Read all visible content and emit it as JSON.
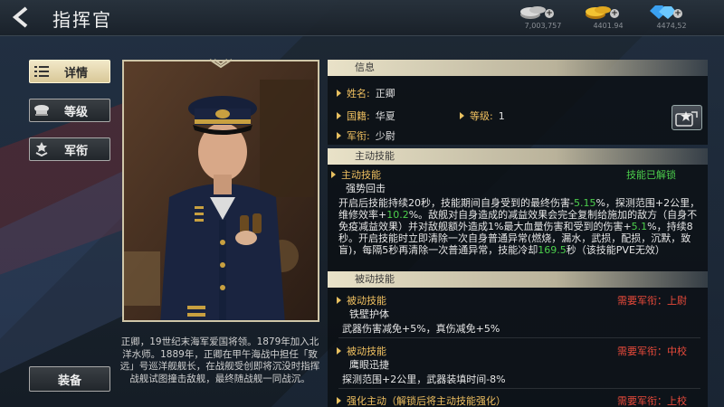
{
  "header": {
    "title": "指挥官",
    "resources": [
      {
        "icon": "silver-coin-icon",
        "amount": "7,003,757"
      },
      {
        "icon": "gold-coin-icon",
        "amount": "4401.94"
      },
      {
        "icon": "diamond-icon",
        "amount": "4474,52"
      }
    ]
  },
  "nav": {
    "items": [
      {
        "label": "详情",
        "icon": "list-icon",
        "active": true
      },
      {
        "label": "等级",
        "icon": "officer-cap-icon",
        "active": false
      },
      {
        "label": "军衔",
        "icon": "rank-chevron-icon",
        "active": false
      }
    ],
    "equip_label": "装备"
  },
  "bio": "正卿，19世纪末海军爱国将领。1879年加入北洋水师。1889年，正卿在甲午海战中担任「致远」号巡洋舰舰长，在战舰受创即将沉没时指挥战舰试图撞击敌舰，最终随战舰一同战沉。",
  "info": {
    "section_title": "信息",
    "name_label": "姓名:",
    "name_value": "正卿",
    "nation_label": "国籍:",
    "nation_value": "华夏",
    "level_label": "等级:",
    "level_value": "1",
    "rank_label": "军衔:",
    "rank_value": "少尉"
  },
  "active_skill": {
    "section_title": "主动技能",
    "label": "主动技能",
    "status": "技能已解锁",
    "name": "强势回击",
    "desc_parts": [
      {
        "text": "开启后技能持续20秒，技能期间自身受到的最终伤害-",
        "color": "white"
      },
      {
        "text": "5.15",
        "color": "green"
      },
      {
        "text": "%，探测范围+2公里，维修效率+",
        "color": "white"
      },
      {
        "text": "10.2",
        "color": "green"
      },
      {
        "text": "%。敌舰对自身造成的减益效果会完全复制给施加的敌方（自身不免疫减益效果）并对敌舰额外造成1%最大血量伤害和受到的伤害+",
        "color": "white"
      },
      {
        "text": "5.1",
        "color": "green"
      },
      {
        "text": "%，持续8秒。开启技能时立即清除一次自身普通异常(燃烧，漏水，武损，配损，沉默，致盲)，每隔5秒再清除一次普通异常，技能冷却",
        "color": "white"
      },
      {
        "text": "169.5",
        "color": "green"
      },
      {
        "text": "秒（该技能PVE无效）",
        "color": "white"
      }
    ]
  },
  "passive_skills": {
    "section_title": "被动技能",
    "items": [
      {
        "label": "被动技能",
        "requirement": "需要军衔：上尉",
        "name": "铁壁护体",
        "desc": "武器伤害减免+5%，真伤减免+5%"
      },
      {
        "label": "被动技能",
        "requirement": "需要军衔：中校",
        "name": "鹰眼迅捷",
        "desc": "探测范围+2公里，武器装填时间-8%"
      },
      {
        "label": "强化主动（解锁后将主动技能强化）",
        "requirement": "需要军衔：上校",
        "name": "",
        "desc": ""
      }
    ]
  }
}
